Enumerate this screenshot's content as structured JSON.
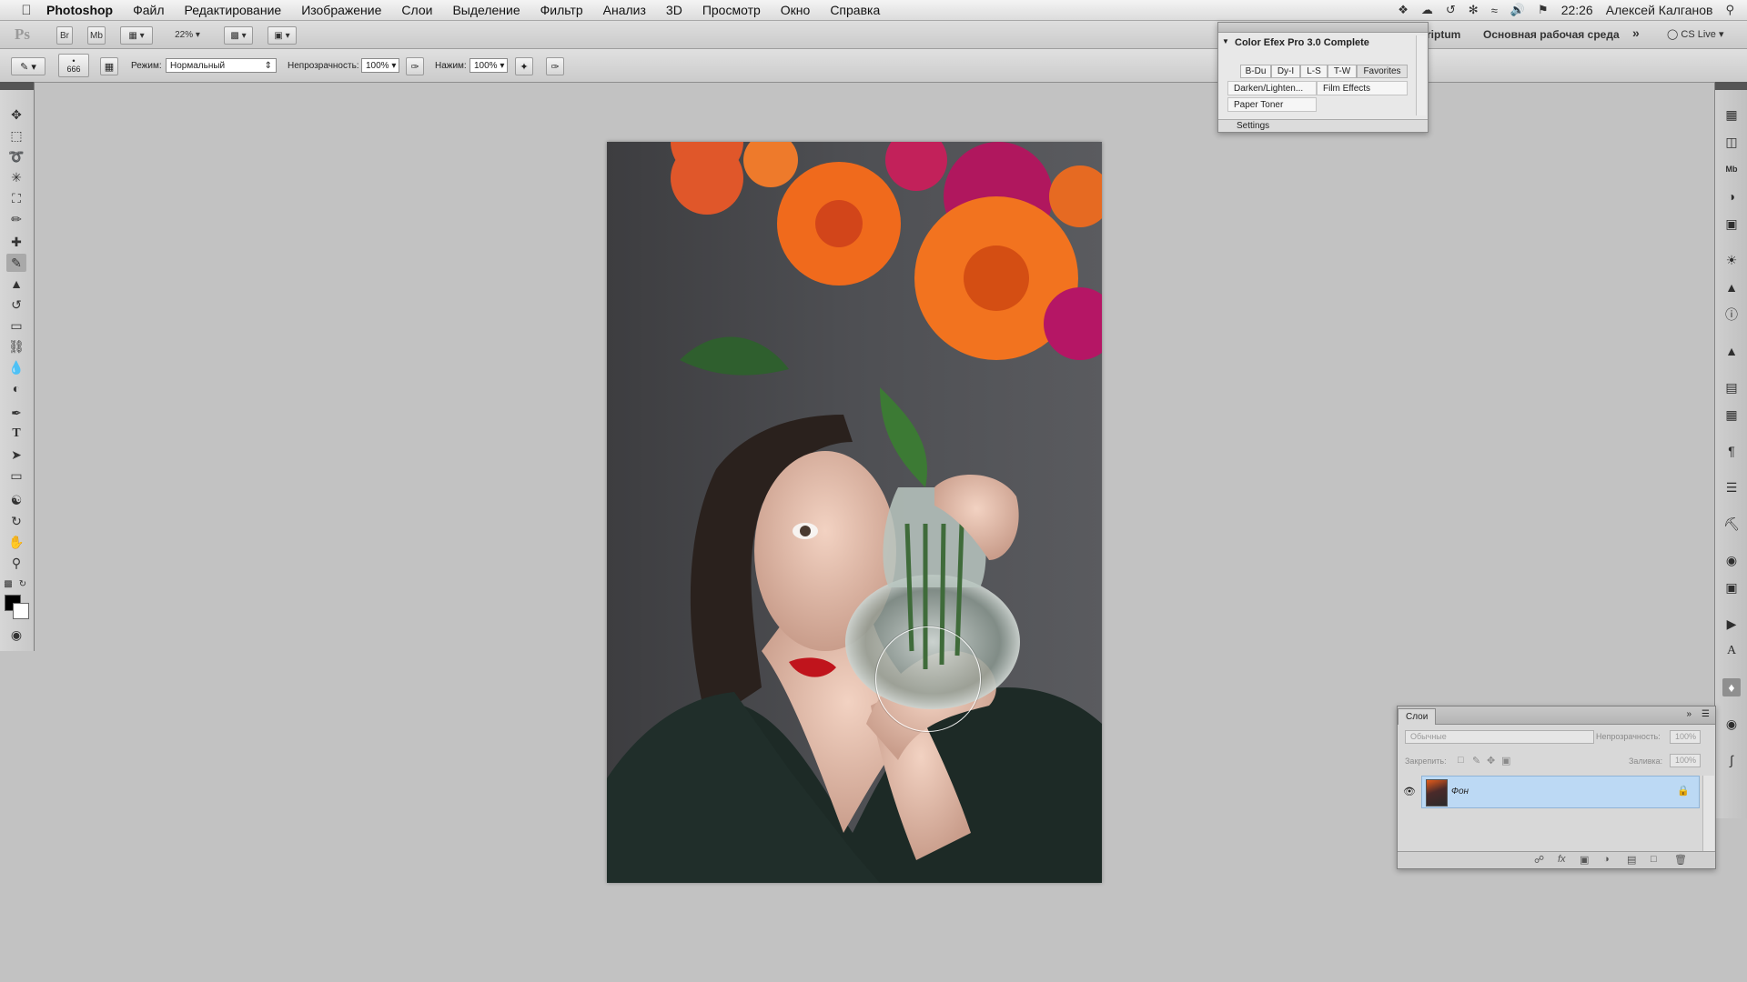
{
  "menubar": {
    "app_name": "Photoshop",
    "items": [
      "Файл",
      "Редактирование",
      "Изображение",
      "Слои",
      "Выделение",
      "Фильтр",
      "Анализ",
      "3D",
      "Просмотр",
      "Окно",
      "Справка"
    ],
    "time": "22:26",
    "user": "Алексей Калганов"
  },
  "appbar": {
    "br_label": "Br",
    "mb_label": "Mb",
    "zoom": "22%",
    "ps_logo": "Ps",
    "workspace_partial": "riptum",
    "workspace": "Основная рабочая среда",
    "cs_live": "CS Live"
  },
  "options": {
    "brush_size": "666",
    "mode_label": "Режим:",
    "mode_value": "Нормальный",
    "opacity_label": "Непрозрачность:",
    "opacity_value": "100%",
    "flow_label": "Нажим:",
    "flow_value": "100%"
  },
  "efex": {
    "title": "Color Efex Pro 3.0 Complete",
    "tabs": [
      "B-Du",
      "Dy-I",
      "L-S",
      "T-W",
      "Favorites"
    ],
    "filters": [
      "Darken/Lighten...",
      "Film Effects",
      "Paper Toner"
    ],
    "settings": "Settings"
  },
  "layers": {
    "tab": "Слои",
    "blend_mode": "Обычные",
    "opacity_label": "Непрозрачность:",
    "opacity_value": "100%",
    "lock_label": "Закрепить:",
    "fill_label": "Заливка:",
    "fill_value": "100%",
    "layer_name": "Фон"
  }
}
